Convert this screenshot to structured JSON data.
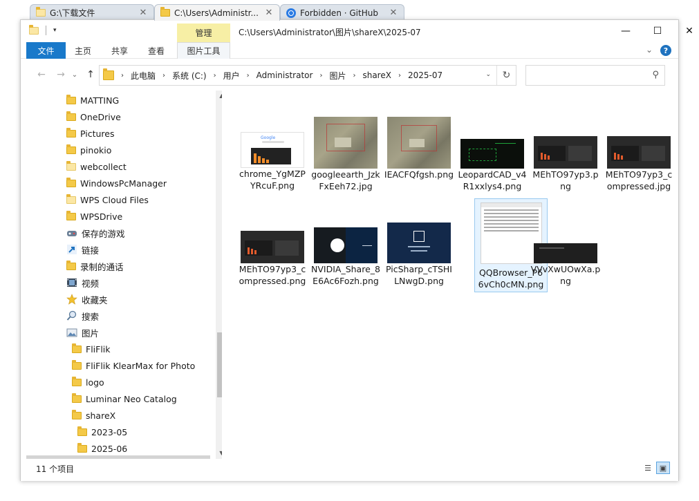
{
  "tabs": [
    {
      "label": "G:\\下载文件",
      "icon": "folder-icon",
      "close": "✕"
    },
    {
      "label": "C:\\Users\\Administr...",
      "icon": "folder-icon",
      "close": "✕"
    },
    {
      "label": "Forbidden · GitHub",
      "icon": "browser-icon",
      "close": "✕"
    }
  ],
  "window": {
    "title": "C:\\Users\\Administrator\\图片\\shareX\\2025-07",
    "context_tab": "管理",
    "minimize": "—",
    "maximize": "☐",
    "close": "✕"
  },
  "ribbon": {
    "tabs": [
      "文件",
      "主页",
      "共享",
      "查看",
      "图片工具"
    ],
    "expand": "⌄",
    "help": "?"
  },
  "nav": {
    "back": "←",
    "forward": "→",
    "recent": "⌄",
    "up": "↑",
    "breadcrumbs": [
      "此电脑",
      "系统 (C:)",
      "用户",
      "Administrator",
      "图片",
      "shareX",
      "2025-07"
    ],
    "crumb_sep": "›",
    "dropdown": "⌄",
    "refresh": "↻",
    "search_placeholder": "",
    "search_icon": "⚲"
  },
  "sidebar": {
    "items": [
      {
        "label": "MATTING",
        "icon": "folder-icon"
      },
      {
        "label": "OneDrive",
        "icon": "folder-icon"
      },
      {
        "label": "Pictures",
        "icon": "folder-icon"
      },
      {
        "label": "pinokio",
        "icon": "folder-icon"
      },
      {
        "label": "webcollect",
        "icon": "folder-icon"
      },
      {
        "label": "WindowsPcManager",
        "icon": "folder-icon"
      },
      {
        "label": "WPS Cloud Files",
        "icon": "folder-icon"
      },
      {
        "label": "WPSDrive",
        "icon": "folder-icon"
      },
      {
        "label": "保存的游戏",
        "icon": "saved-games-icon"
      },
      {
        "label": "链接",
        "icon": "link-icon"
      },
      {
        "label": "录制的通话",
        "icon": "folder-icon"
      },
      {
        "label": "视频",
        "icon": "video-icon"
      },
      {
        "label": "收藏夹",
        "icon": "star-icon"
      },
      {
        "label": "搜索",
        "icon": "search-icon"
      },
      {
        "label": "图片",
        "icon": "pictures-icon"
      },
      {
        "label": "FliFlik",
        "icon": "folder-icon"
      },
      {
        "label": "FliFlik KlearMax for Photo",
        "icon": "folder-icon"
      },
      {
        "label": "logo",
        "icon": "folder-icon"
      },
      {
        "label": "Luminar Neo Catalog",
        "icon": "folder-icon"
      },
      {
        "label": "shareX",
        "icon": "folder-icon"
      },
      {
        "label": "2023-05",
        "icon": "folder-icon"
      },
      {
        "label": "2025-06",
        "icon": "folder-icon"
      }
    ]
  },
  "files": [
    {
      "name": "chrome_YgMZPYRcuF.png",
      "kind": "chrome-thumb"
    },
    {
      "name": "googleearth_JzkFxEeh72.jpg",
      "kind": "aerial-thumb"
    },
    {
      "name": "IEACFQfgsh.png",
      "kind": "aerial-thumb"
    },
    {
      "name": "LeopardCAD_v4R1xxlys4.png",
      "kind": "cad-thumb"
    },
    {
      "name": "MEhTO97yp3.png",
      "kind": "dark-ui-thumb"
    },
    {
      "name": "MEhTO97yp3_compressed.jpg",
      "kind": "dark-ui-thumb"
    },
    {
      "name": "MEhTO97yp3_compressed.png",
      "kind": "dark-ui-thumb"
    },
    {
      "name": "NVIDIA_Share_8E6Ac6Fozh.png",
      "kind": "nvidia-thumb"
    },
    {
      "name": "PicSharp_cTSHILNwgD.png",
      "kind": "picsharp-thumb"
    },
    {
      "name": "QQBrowser_P66vCh0cMN.png",
      "kind": "dialog-thumb"
    },
    {
      "name": "VVvXwUOwXa.png",
      "kind": "dark-strip-thumb"
    }
  ],
  "status": {
    "count": "11 个项目",
    "view_details": "☰",
    "view_thumbs": "▣"
  },
  "colors": {
    "file_tab": "#1979ca",
    "context_tab": "#f7efa5",
    "selection": "#e5f3ff",
    "folder": "#f4c948"
  }
}
